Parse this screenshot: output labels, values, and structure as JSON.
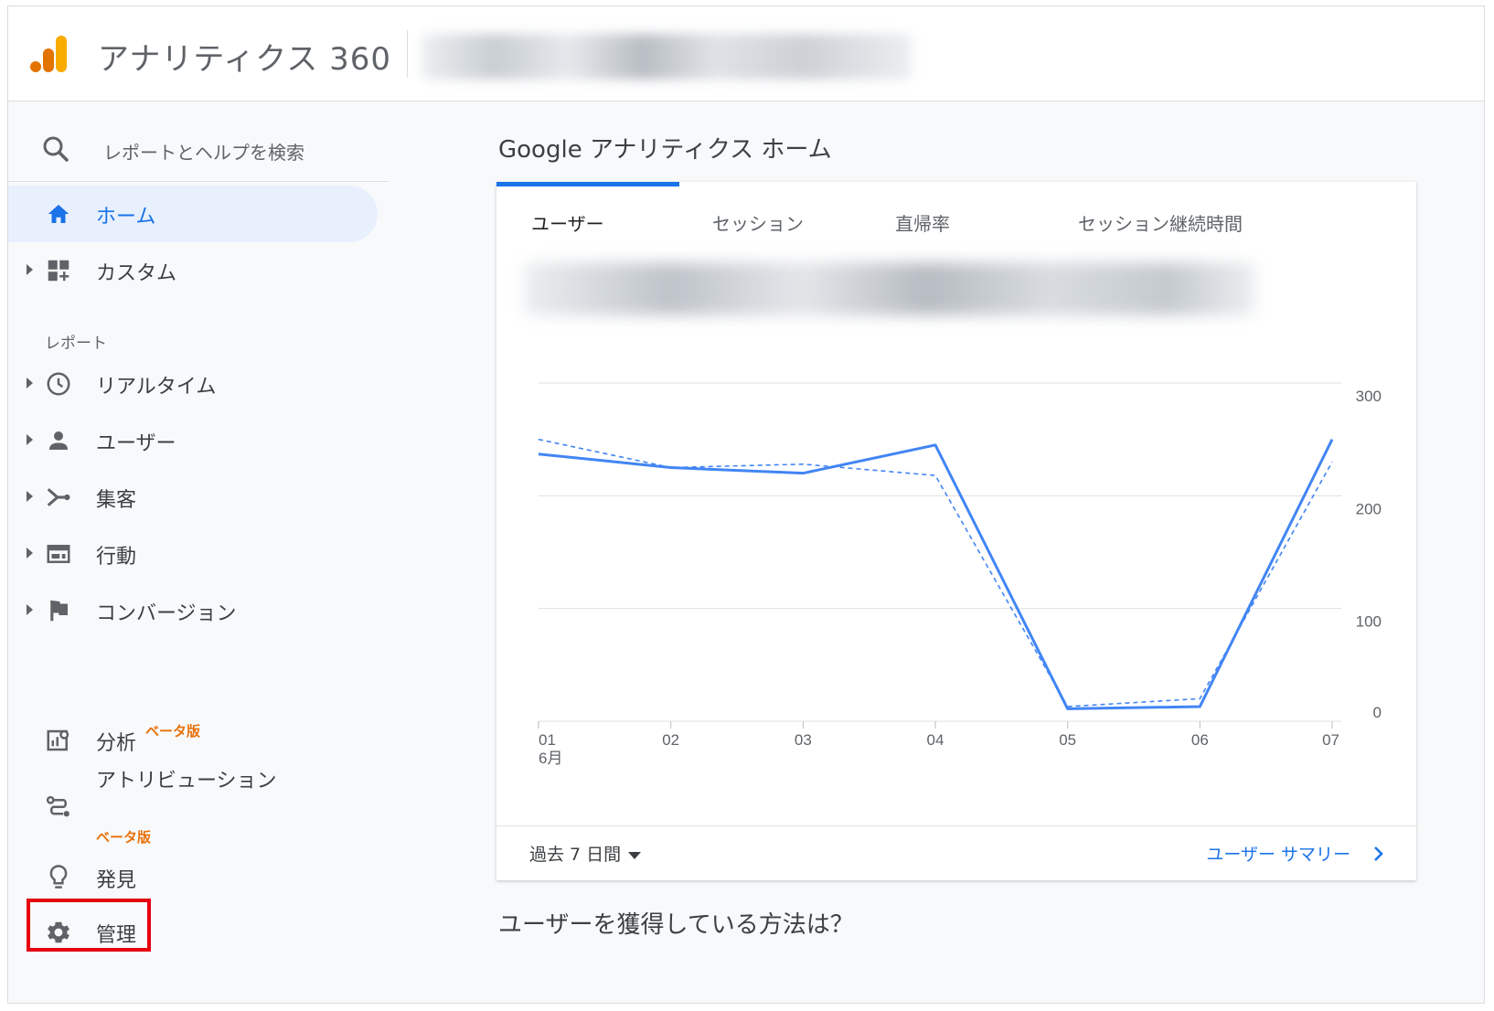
{
  "header": {
    "app_title": "アナリティクス 360"
  },
  "sidebar": {
    "search_placeholder": "レポートとヘルプを検索",
    "items_top": [
      {
        "label": "ホーム",
        "icon": "home-icon",
        "active": true
      },
      {
        "label": "カスタム",
        "icon": "dashboard-icon"
      }
    ],
    "section_reports": "レポート",
    "reports": [
      {
        "label": "リアルタイム",
        "icon": "clock-icon"
      },
      {
        "label": "ユーザー",
        "icon": "person-icon"
      },
      {
        "label": "集客",
        "icon": "acquisition-icon"
      },
      {
        "label": "行動",
        "icon": "behavior-icon"
      },
      {
        "label": "コンバージョン",
        "icon": "flag-icon"
      }
    ],
    "bottom": {
      "analysis": {
        "label": "分析",
        "beta": "ベータ版"
      },
      "attribution": {
        "label": "アトリビューション",
        "beta": "ベータ版"
      },
      "discover": {
        "label": "発見"
      },
      "admin": {
        "label": "管理"
      }
    }
  },
  "main": {
    "title": "Google アナリティクス ホーム",
    "tabs": [
      "ユーザー",
      "セッション",
      "直帰率",
      "セッション継続時間"
    ],
    "period": "過去 7 日間",
    "summary_link": "ユーザー サマリー",
    "subheading": "ユーザーを獲得している方法は？"
  },
  "colors": {
    "accent": "#1a73e8",
    "beta": "#e8710a",
    "highlight": "#e60012",
    "line": "#4285f4"
  },
  "chart_data": {
    "type": "line",
    "categories": [
      "01",
      "02",
      "03",
      "04",
      "05",
      "06",
      "07"
    ],
    "month_label": "6月",
    "series": [
      {
        "style": "solid",
        "values": [
          237,
          225,
          220,
          245,
          11,
          13,
          250
        ]
      },
      {
        "style": "dashed",
        "values": [
          250,
          225,
          228,
          218,
          13,
          20,
          230
        ]
      }
    ],
    "yticks": [
      0,
      100,
      200,
      300
    ],
    "ylim": [
      0,
      300
    ],
    "grid": true
  }
}
